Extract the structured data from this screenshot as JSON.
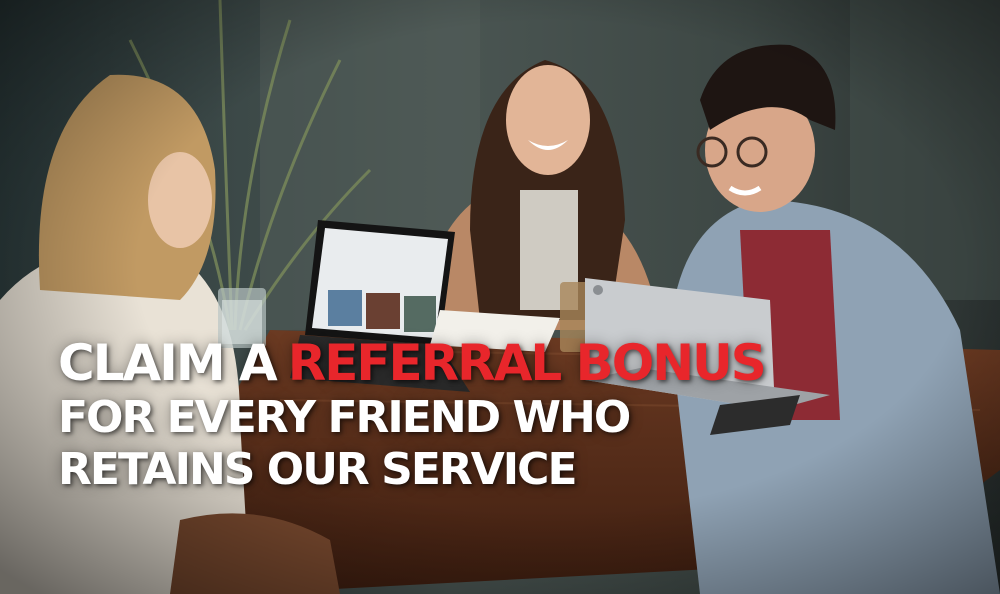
{
  "banner": {
    "line1_white": "CLAIM A",
    "line1_red": "REFERRAL BONUS",
    "line2": "FOR EVERY FRIEND WHO",
    "line3": "RETAINS OUR SERVICE"
  },
  "colors": {
    "text": "#ffffff",
    "accent": "#e8262b"
  },
  "photo": {
    "subject_icon": "photo-background"
  }
}
